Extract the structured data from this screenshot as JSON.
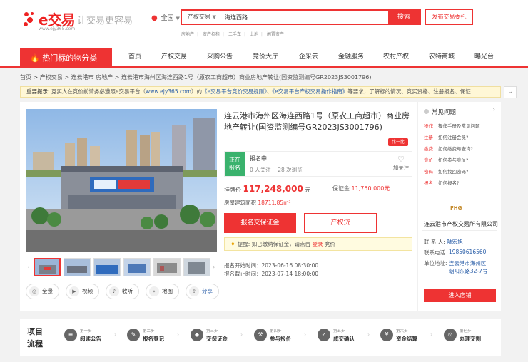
{
  "brand": {
    "name": "e交易",
    "slogan": "让交易更容易",
    "url": "www.ejy365.com",
    "red": "#e33"
  },
  "header": {
    "region": "全国",
    "search_type": "产权交易",
    "search_value": "海连西路",
    "search_button": "搜索",
    "hot_links": [
      "房地产",
      "资产招租",
      "二手车",
      "土地",
      "闲置资产"
    ],
    "post_button": "发布交易委托"
  },
  "nav": {
    "category": "热门标的物分类",
    "items": [
      "首页",
      "产权交易",
      "采购公告",
      "竞价大厅",
      "企采云",
      "金融服务",
      "农村产权",
      "农特商城",
      "曝光台"
    ]
  },
  "breadcrumb": [
    "首页",
    "产权交易",
    "连云港市 房地产",
    "连云港市海州区海连西路1号（原农工商超市）商业房地产转让(国资监测编号GR2023JS3001796)"
  ],
  "notice": {
    "label": "重要提示:",
    "text1": "竞买人在竞价前请务必遵照e交易平台（",
    "link1": "www.ejy365.com",
    "text2": "）的",
    "link2": "《e交易平台竞价交易规则》",
    "text3": "、",
    "link3": "《e交易平台产权交易操作指南》",
    "text4": "等要求，了解标的情况、竞买资格、注册报名、保证"
  },
  "listing": {
    "title": "连云港市海州区海连西路1号（原农工商超市）商业房地产转让(国资监测编号GR2023JS3001796)",
    "compare_tag": "比一比",
    "status_line1": "正在",
    "status_line2": "报名",
    "status_title": "报名中",
    "followers": "0",
    "followers_label": "人关注",
    "views": "28",
    "views_label": "次浏览",
    "follow_label": "加关注",
    "price_label": "挂牌价",
    "price": "117,248,000",
    "price_unit": "元",
    "deposit_label": "保证金",
    "deposit": "11,750,000元",
    "area_label": "房屋建筑面积",
    "area": "18711.85m²",
    "apply_button": "报名交保证金",
    "loan_button": "产权贷",
    "reminder_text": "提醒: 如已缴纳保证金，请点击",
    "reminder_link": "登录",
    "reminder_tail": "竞价",
    "start_label": "报名开始时间：",
    "start_time": "2023-06-16 08:30:00",
    "end_label": "报名截止时间：",
    "end_time": "2023-07-14 18:00:00"
  },
  "tools": [
    "全景",
    "视频",
    "收听",
    "地图",
    "分享"
  ],
  "faq": {
    "title": "常见问题",
    "items": [
      {
        "k": "操作",
        "v": "操作手册及常见问题"
      },
      {
        "k": "注册",
        "v": "如何注册会员?"
      },
      {
        "k": "缴费",
        "v": "如何缴费与查询?"
      },
      {
        "k": "竞价",
        "v": "如何参与竞价?"
      },
      {
        "k": "密码",
        "v": "如何找回密码?"
      },
      {
        "k": "报名",
        "v": "如何报名?"
      }
    ]
  },
  "org": {
    "logo": "FHG",
    "name": "连云港市产权交易所有限公司",
    "contact_label": "联 系 人:",
    "contact": "陆宏旭",
    "phone_label": "联系电话:",
    "phone": "19850616560",
    "address_label": "单位地址:",
    "address1": "连云港市海州区",
    "address2": "朝阳东路32-7号",
    "enter_button": "进入店铺"
  },
  "flow": {
    "label": "项目流程",
    "steps": [
      {
        "no": "第一步",
        "name": "阅读公告"
      },
      {
        "no": "第二步",
        "name": "报名登记"
      },
      {
        "no": "第三步",
        "name": "交保证金"
      },
      {
        "no": "第四步",
        "name": "参与报价"
      },
      {
        "no": "第五步",
        "name": "成交确认"
      },
      {
        "no": "第六步",
        "name": "资金结算"
      },
      {
        "no": "第七步",
        "name": "办理交割"
      }
    ]
  }
}
